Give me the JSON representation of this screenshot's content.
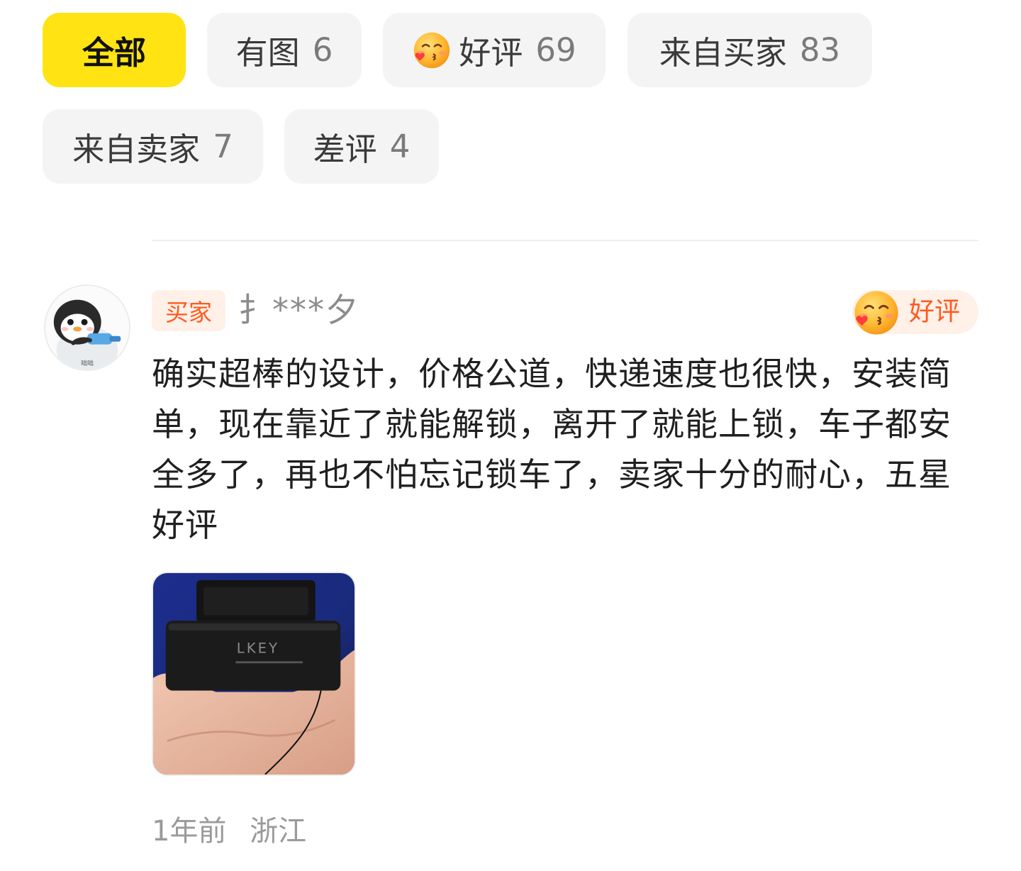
{
  "filters": [
    {
      "label": "全部",
      "count": "",
      "active": true
    },
    {
      "label": "有图",
      "count": "6",
      "active": false
    },
    {
      "label": "好评",
      "count": "69",
      "active": false,
      "icon": "kissing-face-icon"
    },
    {
      "label": "来自买家",
      "count": "83",
      "active": false
    },
    {
      "label": "来自卖家",
      "count": "7",
      "active": false
    },
    {
      "label": "差评",
      "count": "4",
      "active": false
    }
  ],
  "review": {
    "avatar_icon": "penguin-avatar-icon",
    "avatar_caption": "咄咄",
    "role_tag": "买家",
    "username": "扌***夕",
    "rating_label": "好评",
    "rating_icon": "kissing-face-icon",
    "text": "确实超棒的设计，价格公道，快递速度也很快，安装简单，现在靠近了就能解锁，离开了就能上锁，车子都安全多了，再也不怕忘记锁车了，卖家十分的耐心，五星好评",
    "photo_label": "LKEY",
    "time": "1年前",
    "location": "浙江"
  },
  "colors": {
    "active_chip": "#ffe313",
    "chip_bg": "#f4f4f4",
    "accent_orange": "#ff5a1f",
    "tag_bg": "#fff0e8"
  }
}
